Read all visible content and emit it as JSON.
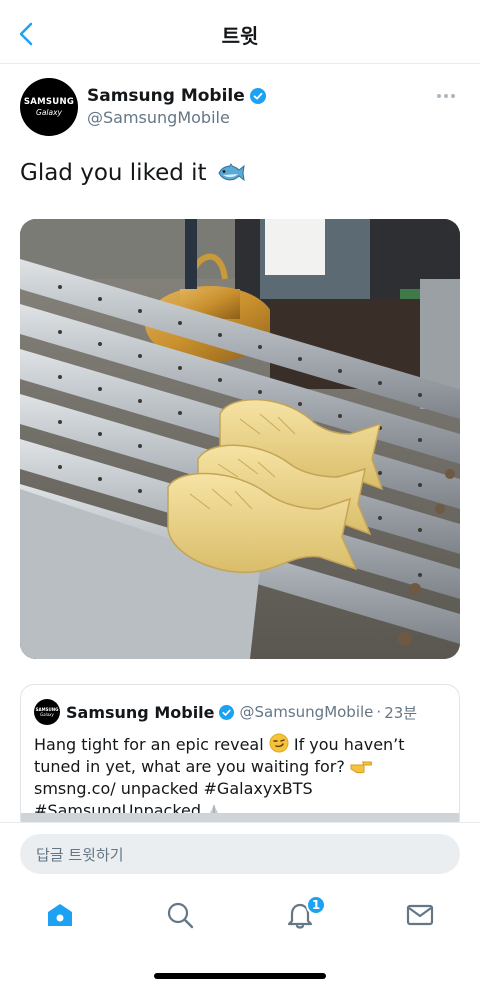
{
  "header": {
    "title": "트윗"
  },
  "tweet": {
    "author": {
      "name": "Samsung Mobile",
      "handle": "@SamsungMobile",
      "avatar_line1": "SAMSUNG",
      "avatar_line2": "Galaxy",
      "verified": true
    },
    "text": "Glad you liked it",
    "emoji_icon": "fish-icon",
    "media": {
      "icon": "photo-taiyaki-grill"
    }
  },
  "quote_tweet": {
    "name": "Samsung Mobile",
    "handle": "@SamsungMobile",
    "time": "23분",
    "avatar_line1": "SAMSUNG",
    "avatar_line2": "Galaxy",
    "text_part1": "Hang tight for an epic reveal",
    "text_part2": "If you haven’t tuned in yet, what are you waiting for?",
    "text_part3": "smsng.co/ unpacked #GalaxyxBTS #SamsungUnpacked"
  },
  "reply": {
    "placeholder": "답글 트윗하기"
  },
  "tabbar": {
    "items": [
      "home-icon",
      "search-icon",
      "bell-icon",
      "mail-icon"
    ],
    "notification_count": "1"
  },
  "colors": {
    "accent": "#1da1f2",
    "text": "#14171a",
    "secondary": "#657786"
  }
}
